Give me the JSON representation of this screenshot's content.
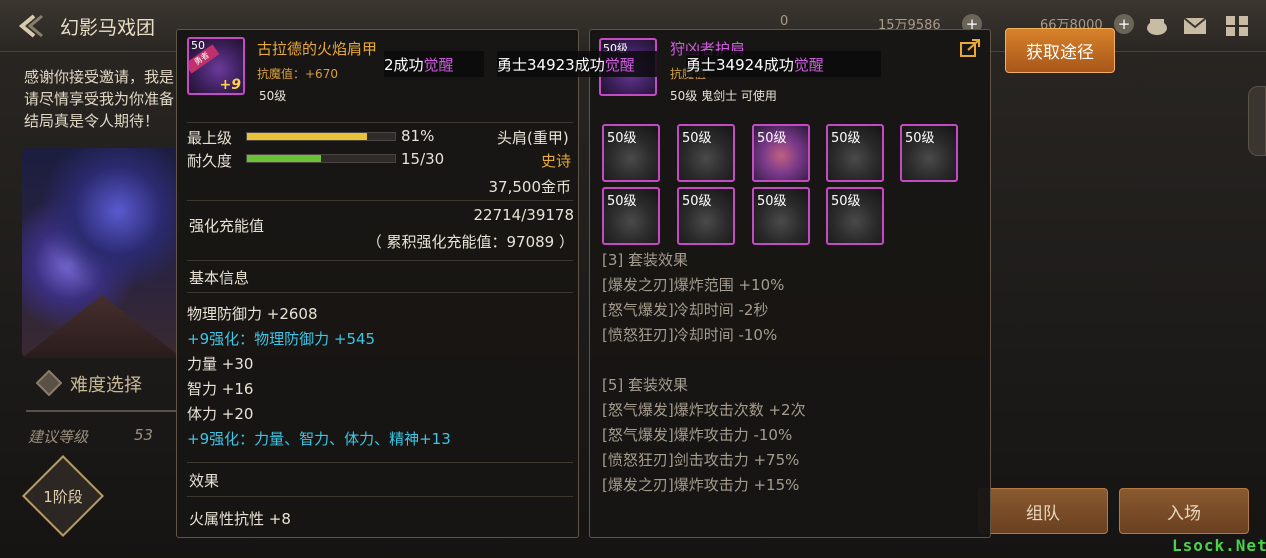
{
  "scene": {
    "title": "幻影马戏团",
    "resources": [
      "0",
      "15万9586",
      "66万8000"
    ],
    "intro": "感谢你接受邀请，我是\n请尽情享受我为你准备\n结局真是令人期待！",
    "difficulty_label": "难度选择",
    "recommended_level_label": "建议等级",
    "recommended_level_value": "53",
    "stage_label": "1阶段",
    "acquire_button": "获取途径",
    "team_button": "组队",
    "enter_button": "入场",
    "watermark": "Lsock.Net"
  },
  "notices": {
    "left_prefix": "2成功",
    "left_awaken": "觉醒",
    "mid_text": "勇士34923成功",
    "mid_awaken": "觉醒",
    "right_text": "勇士34924成功",
    "right_awaken": "觉醒"
  },
  "left_item": {
    "icon_level": "50",
    "icon_tag": "勇者",
    "icon_plus": "+9",
    "name": "古拉德的火焰肩甲",
    "demon_resist": "抗魔值：+670",
    "level": "50级",
    "max_level_label": "最上级",
    "max_level_pct": "81%",
    "max_level_fraction": 0.81,
    "durability_label": "耐久度",
    "durability_value": "15/30",
    "durability_fraction": 0.5,
    "slot_type": "头肩(重甲)",
    "rarity": "史诗",
    "price": "37,500金币",
    "reinforce_label": "强化充能值",
    "reinforce_value": "22714/39178",
    "reinforce_total": "（ 累积强化充能值：97089 ）",
    "basic_info_label": "基本信息",
    "stats": [
      {
        "text": "物理防御力 +2608",
        "cyan": false
      },
      {
        "text": "+9强化：物理防御力 +545",
        "cyan": true
      },
      {
        "text": "力量 +30",
        "cyan": false
      },
      {
        "text": "智力 +16",
        "cyan": false
      },
      {
        "text": "体力 +20",
        "cyan": false
      },
      {
        "text": "+9强化：力量、智力、体力、精神+13",
        "cyan": true
      }
    ],
    "effect_label": "效果",
    "effect_value": "火属性抗性 +8",
    "colors": {
      "name": "#e7a93a",
      "cyan": "#3cc6e6",
      "bar_gold": "#e8c23a",
      "bar_green": "#6ac23a",
      "border": "#c54bc5"
    }
  },
  "right_item": {
    "icon_level": "50级",
    "name": "狩凶者护肩",
    "demon_resist": "抗魔值",
    "level_info": "50级 鬼剑士 可使用",
    "slots": [
      "50级",
      "50级",
      "50级",
      "50级",
      "50级",
      "50级",
      "50级",
      "50级",
      "50级"
    ],
    "set_effects": [
      "[3] 套装效果",
      "[爆发之刃]爆炸范围 +10%",
      "[怒气爆发]冷却时间 -2秒",
      "[愤怒狂刃]冷却时间 -10%",
      "",
      "[5] 套装效果",
      "[怒气爆发]爆炸攻击次数 +2次",
      "[怒气爆发]爆炸攻击力 -10%",
      "[愤怒狂刃]剑击攻击力 +75%",
      "[爆发之刃]爆炸攻击力 +15%"
    ]
  }
}
